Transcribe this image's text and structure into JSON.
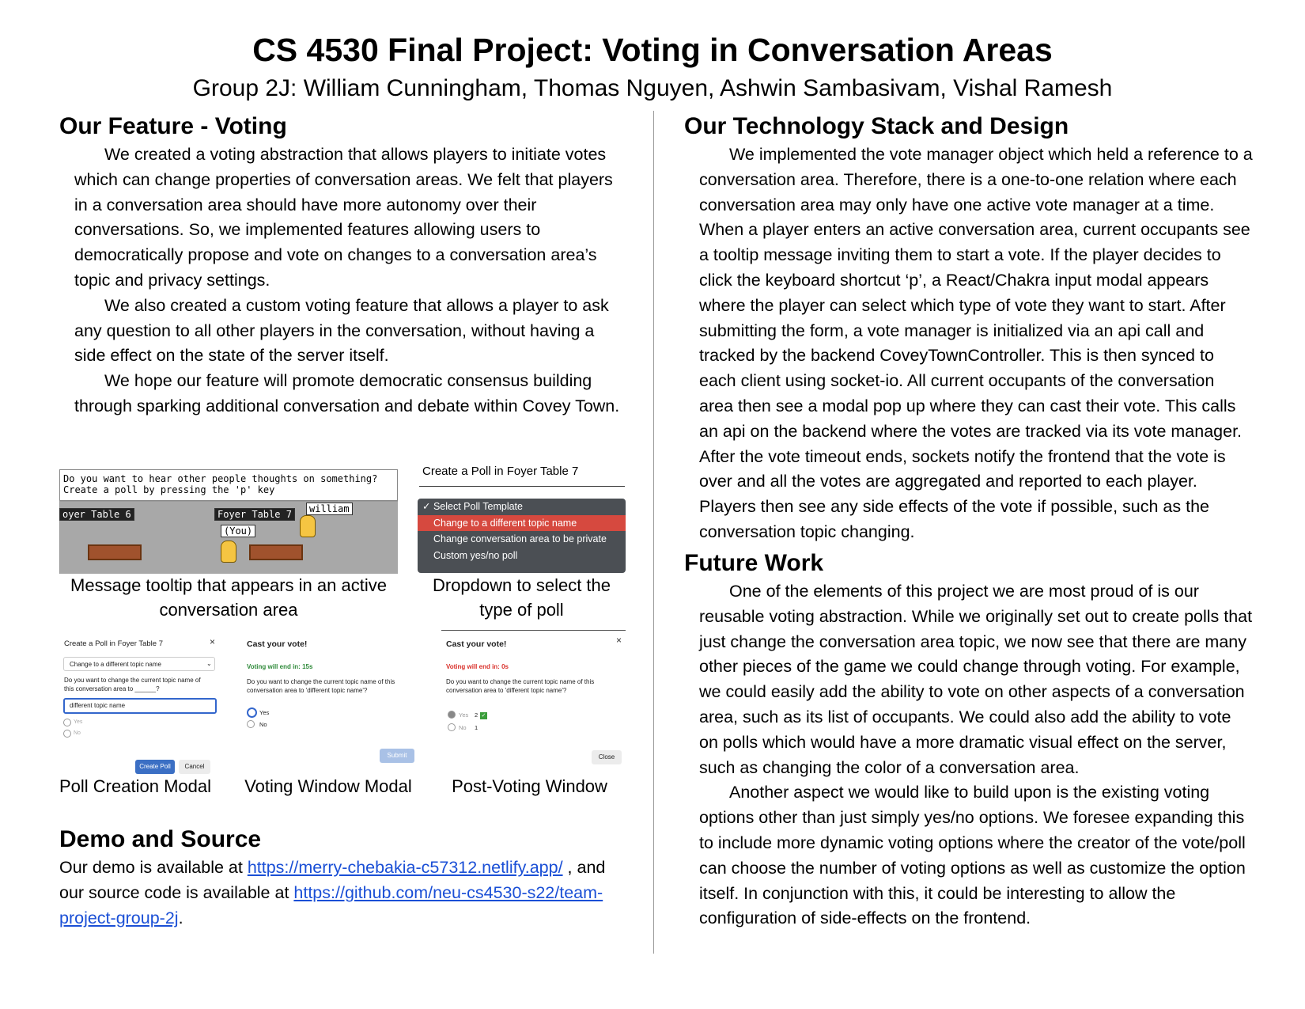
{
  "header": {
    "title": "CS 4530 Final Project: Voting in Conversation Areas",
    "authors": "Group 2J: William Cunningham, Thomas Nguyen, Ashwin Sambasivam, Vishal Ramesh"
  },
  "feature": {
    "heading": "Our Feature - Voting",
    "paragraphs": [
      "We created a voting abstraction that allows players to initiate votes which can change properties of conversation areas. We felt that players in a conversation area should have more autonomy over their conversations. So, we implemented features allowing users to democratically propose and vote on changes to a conversation area’s topic and privacy settings.",
      "We also created a custom voting feature that allows a player to ask any question to all other players in the conversation, without having a side effect on the state of the server itself.",
      "We hope our feature will promote democratic consensus building through sparking additional conversation and debate within Covey Town."
    ]
  },
  "screens": {
    "tooltip": {
      "line1": "Do you want to hear other people thoughts on something?",
      "line2": "Create a poll by pressing the 'p' key",
      "table6": "oyer Table 6",
      "table7": "Foyer Table 7",
      "william": "william",
      "you": "(You)",
      "caption": "Message tooltip that appears in an active conversation area"
    },
    "dropdown": {
      "title": "Create a Poll in Foyer Table 7",
      "options": [
        "✓ Select Poll Template",
        "Change to a different topic name",
        "Change conversation area to be private",
        "Custom yes/no poll"
      ],
      "caption": "Dropdown to select the type of poll"
    },
    "creation": {
      "title": "Create a Poll in Foyer Table 7",
      "select": "Change to a different topic name",
      "question": "Do you want to change the current topic name of this conversation area to ______?",
      "input": "different topic name",
      "yes": "Yes",
      "no": "No",
      "create": "Create Poll",
      "cancel": "Cancel",
      "caption": "Poll Creation Modal"
    },
    "voting": {
      "title": "Cast your vote!",
      "timer": "Voting will end in: 15s",
      "question": "Do you want to change the current topic name of this conversation area to 'different topic name'?",
      "yes": "Yes",
      "no": "No",
      "submit": "Submit",
      "caption": "Voting Window Modal"
    },
    "post": {
      "title": "Cast your vote!",
      "timer": "Voting will end in: 0s",
      "question": "Do you want to change the current topic name of this conversation area to 'different topic name'?",
      "yes": "Yes",
      "yes_count": "2",
      "no": "No",
      "no_count": "1",
      "close": "Close",
      "caption": "Post-Voting Window"
    }
  },
  "demo": {
    "heading": "Demo and Source",
    "text1": "Our demo is available at ",
    "demo_url": "https://merry-chebakia-c57312.netlify.app/",
    "text2": " , and our source code is available at ",
    "source_url": "https://github.com/neu-cs4530-s22/team-project-group-2j",
    "text3": "."
  },
  "tech": {
    "heading": "Our Technology Stack and Design",
    "paragraphs": [
      "We implemented the vote manager object which held a reference to a conversation area. Therefore, there is a one-to-one relation where each conversation area may only have one active vote manager at a time. When a player enters an active conversation area, current occupants see a tooltip message inviting them to start a vote. If the player decides to click the keyboard shortcut ‘p’, a React/Chakra input modal appears where the player can select which type of vote they want to start. After submitting the form, a vote manager is initialized via an api call and tracked by the backend CoveyTownController. This is then synced to each client using socket-io. All current occupants of the conversation area then see a modal pop up where they can cast their vote. This calls an api on the backend where the votes are tracked via its vote manager. After the vote timeout ends, sockets notify the frontend that the vote is over and all the votes are aggregated and reported to each player. Players then see any side effects of the vote if possible, such as the conversation topic changing."
    ]
  },
  "future": {
    "heading": "Future Work",
    "paragraphs": [
      "One of the elements of this project we are most proud of is our reusable voting abstraction. While we originally set out to create polls that just change the conversation area topic, we now see that there are many other pieces of the game we could change through voting. For example, we could easily add the ability to vote on other aspects of a conversation area, such as its list of occupants. We could also add the ability to vote on polls which would have a more dramatic visual effect on the server, such as changing the color of a conversation area.",
      "Another aspect we would like to build upon is the existing voting options other than just simply yes/no options. We foresee expanding this to include more dynamic voting options where the creator of the vote/poll can choose the number of voting options as well as customize the option itself. In conjunction with this, it could be interesting to allow the configuration of side-effects on the frontend."
    ]
  }
}
